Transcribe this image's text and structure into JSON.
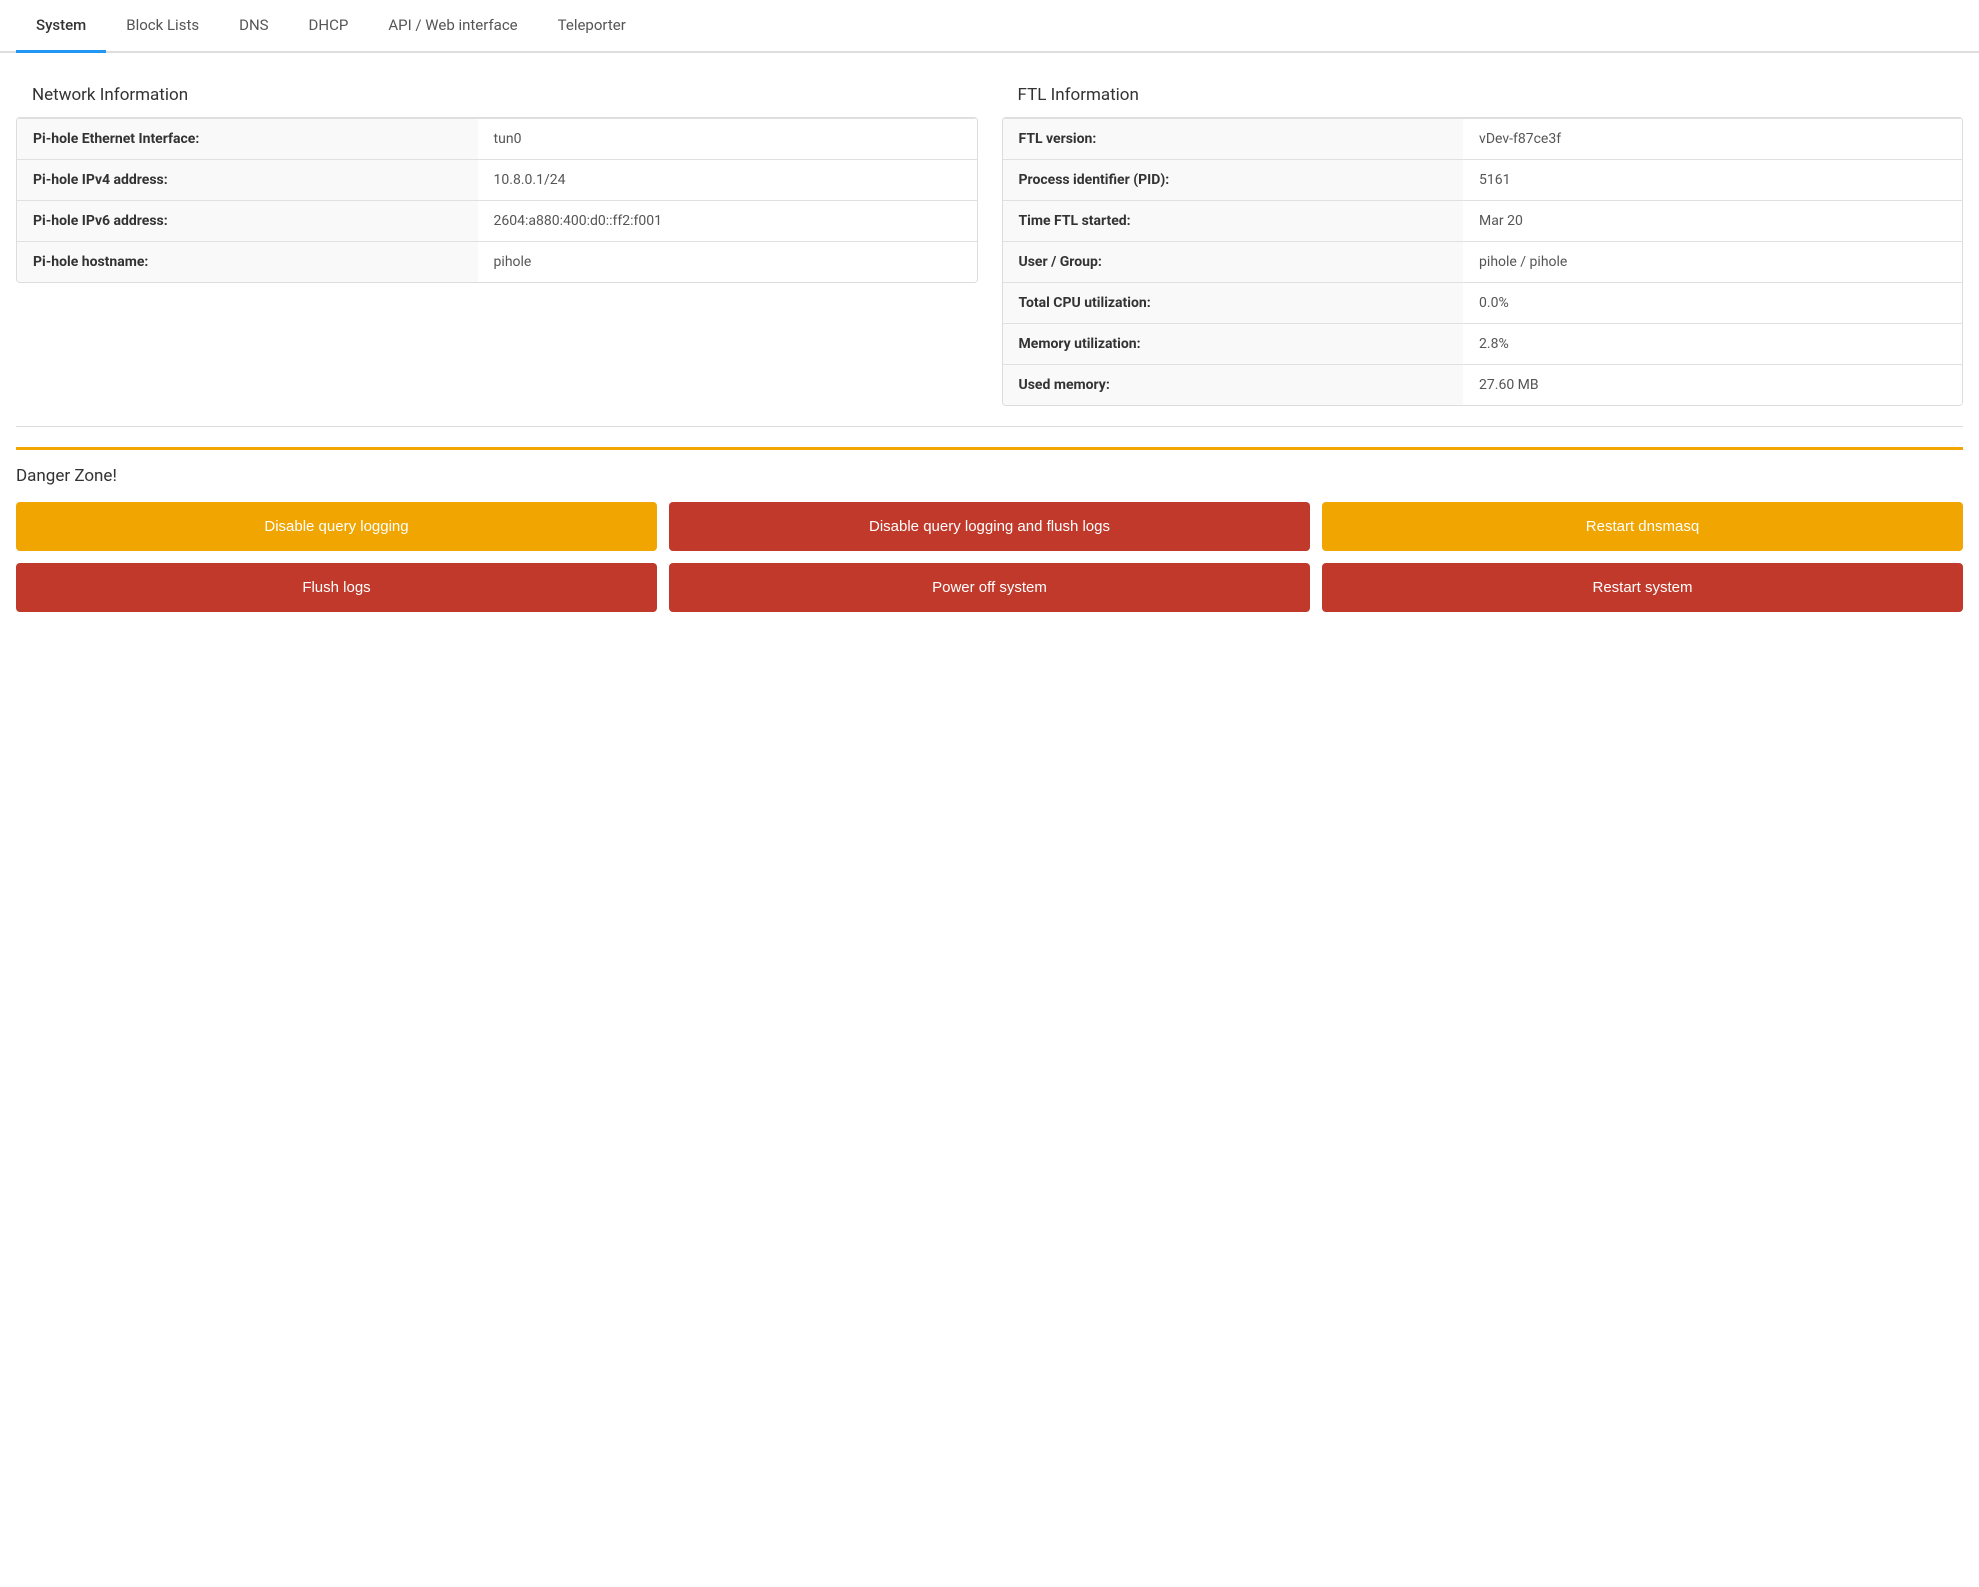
{
  "tabs": [
    {
      "label": "System",
      "active": true
    },
    {
      "label": "Block Lists",
      "active": false
    },
    {
      "label": "DNS",
      "active": false
    },
    {
      "label": "DHCP",
      "active": false
    },
    {
      "label": "API / Web interface",
      "active": false
    },
    {
      "label": "Teleporter",
      "active": false
    }
  ],
  "network": {
    "title": "Network Information",
    "rows": [
      {
        "label": "Pi-hole Ethernet Interface:",
        "value": "tun0"
      },
      {
        "label": "Pi-hole IPv4 address:",
        "value": "10.8.0.1/24"
      },
      {
        "label": "Pi-hole IPv6 address:",
        "value": "2604:a880:400:d0::ff2:f001"
      },
      {
        "label": "Pi-hole hostname:",
        "value": "pihole"
      }
    ]
  },
  "ftl": {
    "title": "FTL Information",
    "rows": [
      {
        "label": "FTL version:",
        "value": "vDev-f87ce3f"
      },
      {
        "label": "Process identifier (PID):",
        "value": "5161"
      },
      {
        "label": "Time FTL started:",
        "value": "Mar 20"
      },
      {
        "label": "User / Group:",
        "value": "pihole / pihole"
      },
      {
        "label": "Total CPU utilization:",
        "value": "0.0%"
      },
      {
        "label": "Memory utilization:",
        "value": "2.8%"
      },
      {
        "label": "Used memory:",
        "value": "27.60 MB"
      }
    ]
  },
  "dangerZone": {
    "title": "Danger Zone!",
    "buttons": [
      {
        "label": "Disable query logging",
        "style": "orange",
        "row": 1,
        "col": 1
      },
      {
        "label": "Disable query logging and flush logs",
        "style": "red",
        "row": 1,
        "col": 2
      },
      {
        "label": "Restart dnsmasq",
        "style": "orange",
        "row": 1,
        "col": 3
      },
      {
        "label": "Flush logs",
        "style": "red",
        "row": 2,
        "col": 1
      },
      {
        "label": "Power off system",
        "style": "red",
        "row": 2,
        "col": 2
      },
      {
        "label": "Restart system",
        "style": "red",
        "row": 2,
        "col": 3
      }
    ]
  }
}
